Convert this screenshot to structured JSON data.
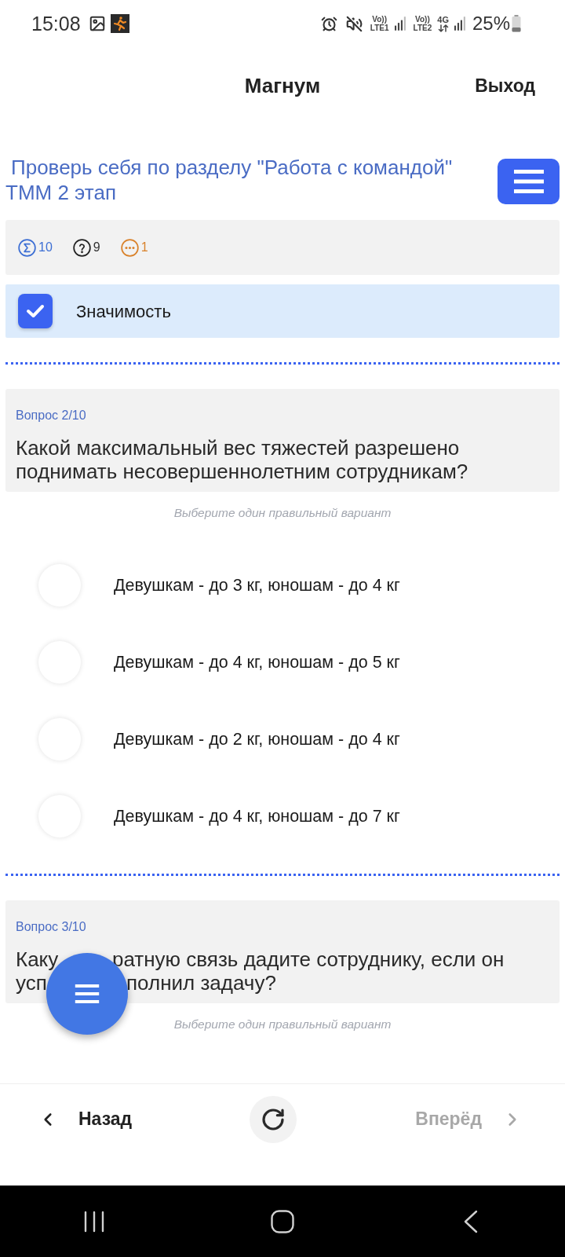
{
  "status_bar": {
    "time": "15:08",
    "sim_labels": [
      {
        "top": "Vo))",
        "bottom": "LTE1"
      },
      {
        "top": "Vo))",
        "bottom": "LTE2"
      }
    ],
    "data_label": "4G",
    "battery": "25%"
  },
  "header": {
    "title": "Магнум",
    "action": "Выход"
  },
  "test": {
    "title": "Проверь себя по разделу \"Работа с командой\" ТММ 2 этап"
  },
  "stats": [
    {
      "kind": "total",
      "value": "10"
    },
    {
      "kind": "unanswered",
      "value": "9"
    },
    {
      "kind": "skipped",
      "value": "1"
    }
  ],
  "filter": {
    "label": "Значимость",
    "checked": true
  },
  "questions": [
    {
      "number": "Вопрос 2/10",
      "text": "Какой максимальный вес тяжестей разрешено поднимать несовершеннолетним сотрудникам?",
      "hint": "Выберите один правильный вариант",
      "options": [
        {
          "label": "Девушкам - до 3 кг, юношам - до 4 кг",
          "selected": false
        },
        {
          "label": "Девушкам - до 4 кг, юношам - до 5 кг",
          "selected": false
        },
        {
          "label": "Девушкам - до 2 кг, юношам - до 4 кг",
          "selected": false
        },
        {
          "label": "Девушкам - до 4 кг, юношам - до 7 кг",
          "selected": false
        }
      ]
    },
    {
      "number": "Вопрос 3/10",
      "text_lines": [
        [
          "Каку",
          "ратную связь дадите сотруднику, если он"
        ],
        [
          "усп",
          "полнил задачу?"
        ]
      ],
      "hint": "Выберите один правильный вариант"
    }
  ],
  "navigation": {
    "back": {
      "label": "Назад",
      "disabled": false
    },
    "forward": {
      "label": "Вперёд",
      "disabled": true
    }
  }
}
